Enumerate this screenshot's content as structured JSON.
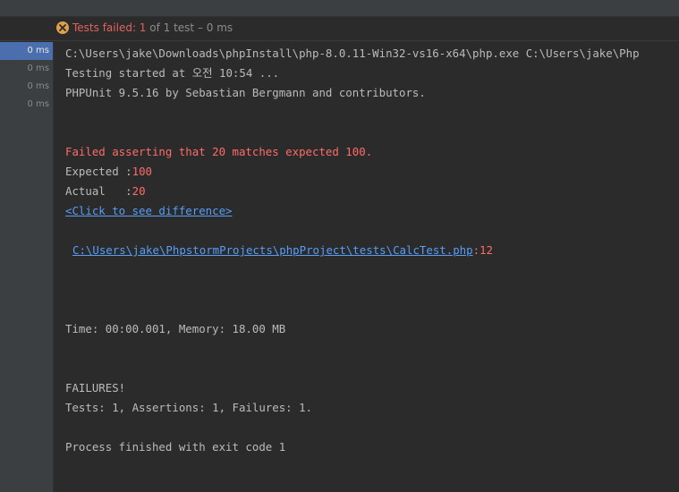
{
  "status": {
    "icon": "error-circle-icon",
    "failed_label": "Tests failed: 1",
    "summary": "of 1 test – 0 ms"
  },
  "tests": {
    "rows": [
      {
        "time": "0 ms"
      },
      {
        "time": "0 ms"
      },
      {
        "time": "0 ms"
      },
      {
        "time": "0 ms"
      }
    ]
  },
  "console": {
    "command": "C:\\Users\\jake\\Downloads\\phpInstall\\php-8.0.11-Win32-vs16-x64\\php.exe C:\\Users\\jake\\Php",
    "started": "Testing started at 오전 10:54 ...",
    "phpunit": "PHPUnit 9.5.16 by Sebastian Bergmann and contributors.",
    "failed_assert": "Failed asserting that 20 matches expected 100.",
    "expected_label": "Expected :",
    "expected_value": "100",
    "actual_label": "Actual   :",
    "actual_value": "20",
    "diff_link": "<Click to see difference>",
    "file_link": "C:\\Users\\jake\\PhpstormProjects\\phpProject\\tests\\CalcTest.php",
    "file_line": ":12",
    "time_memory": "Time: 00:00.001, Memory: 18.00 MB",
    "failures": "FAILURES!",
    "counts": "Tests: 1, Assertions: 1, Failures: 1.",
    "exit": "Process finished with exit code 1"
  },
  "colors": {
    "error_red": "#ff6b68",
    "link_blue": "#589df6",
    "selection": "#4b6eaf",
    "background": "#2b2b2b"
  }
}
